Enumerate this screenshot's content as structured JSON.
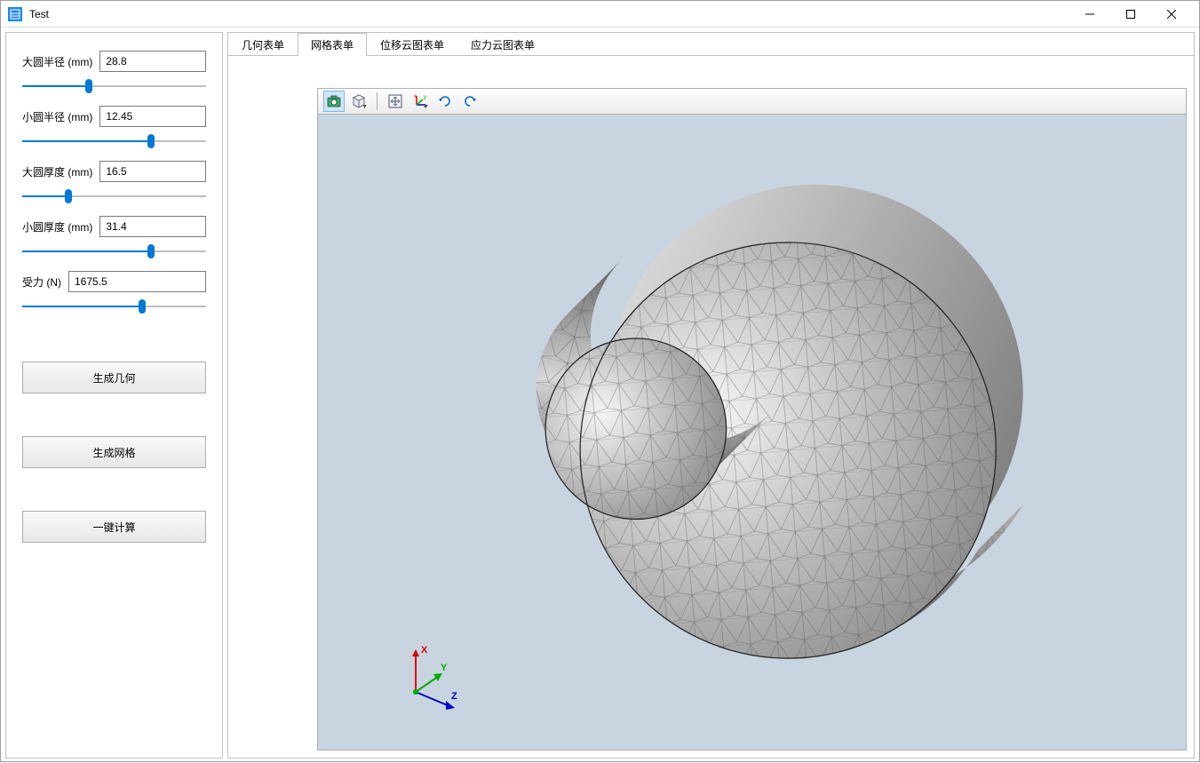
{
  "window": {
    "title": "Test"
  },
  "sidebar": {
    "params": [
      {
        "label": "大圆半径 (mm)",
        "value": "28.8",
        "fill_pct": 36
      },
      {
        "label": "小圆半径 (mm)",
        "value": "12.45",
        "fill_pct": 70
      },
      {
        "label": "大圆厚度 (mm)",
        "value": "16.5",
        "fill_pct": 25
      },
      {
        "label": "小圆厚度 (mm)",
        "value": "31.4",
        "fill_pct": 70
      },
      {
        "label": "受力 (N)",
        "value": "1675.5",
        "fill_pct": 65
      }
    ],
    "buttons": {
      "gen_geom": "生成几何",
      "gen_mesh": "生成网格",
      "compute": "一键计算"
    }
  },
  "tabs": {
    "items": [
      "几何表单",
      "网格表单",
      "位移云图表单",
      "应力云图表单"
    ],
    "active": 1
  },
  "toolbar": {
    "icons": [
      {
        "name": "snapshot-icon",
        "active": true,
        "dropdown": false
      },
      {
        "name": "view-cube-icon",
        "active": false,
        "dropdown": true
      },
      {
        "sep": true
      },
      {
        "name": "fit-view-icon",
        "active": false,
        "dropdown": false
      },
      {
        "name": "axes-icon",
        "active": false,
        "dropdown": true
      },
      {
        "name": "rotate-cw-icon",
        "active": false,
        "dropdown": false
      },
      {
        "name": "rotate-ccw-icon",
        "active": false,
        "dropdown": false
      }
    ]
  },
  "axis_labels": {
    "x": "X",
    "y": "Y",
    "z": "Z"
  }
}
